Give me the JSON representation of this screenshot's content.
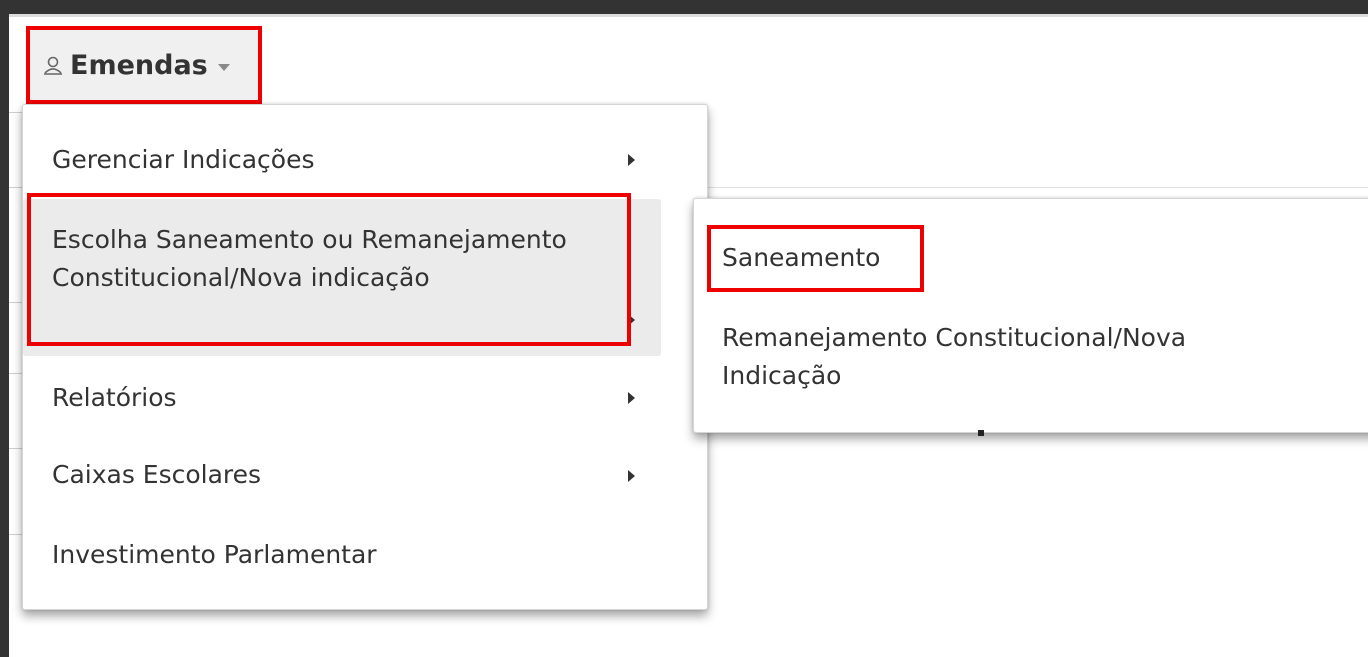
{
  "trigger": {
    "label": "Emendas",
    "icon": "user-icon",
    "caret_icon": "caret-down-icon"
  },
  "menu": {
    "items": [
      {
        "label": "Gerenciar Indicações",
        "has_submenu": true
      },
      {
        "label_line1": "Escolha Saneamento ou Remanejamento",
        "label_line2": "Constitucional/Nova indicação",
        "has_submenu": true,
        "active": true
      },
      {
        "label": "Relatórios",
        "has_submenu": true
      },
      {
        "label": "Caixas Escolares",
        "has_submenu": true
      },
      {
        "label": "Investimento Parlamentar",
        "has_submenu": false
      }
    ]
  },
  "submenu": {
    "items": [
      {
        "label": "Saneamento"
      },
      {
        "label_line1": "Remanejamento Constitucional/Nova",
        "label_line2": "Indicação"
      }
    ]
  },
  "colors": {
    "highlight_box": "#ee0000",
    "hover_bg": "#ebebeb",
    "text": "#333333"
  }
}
